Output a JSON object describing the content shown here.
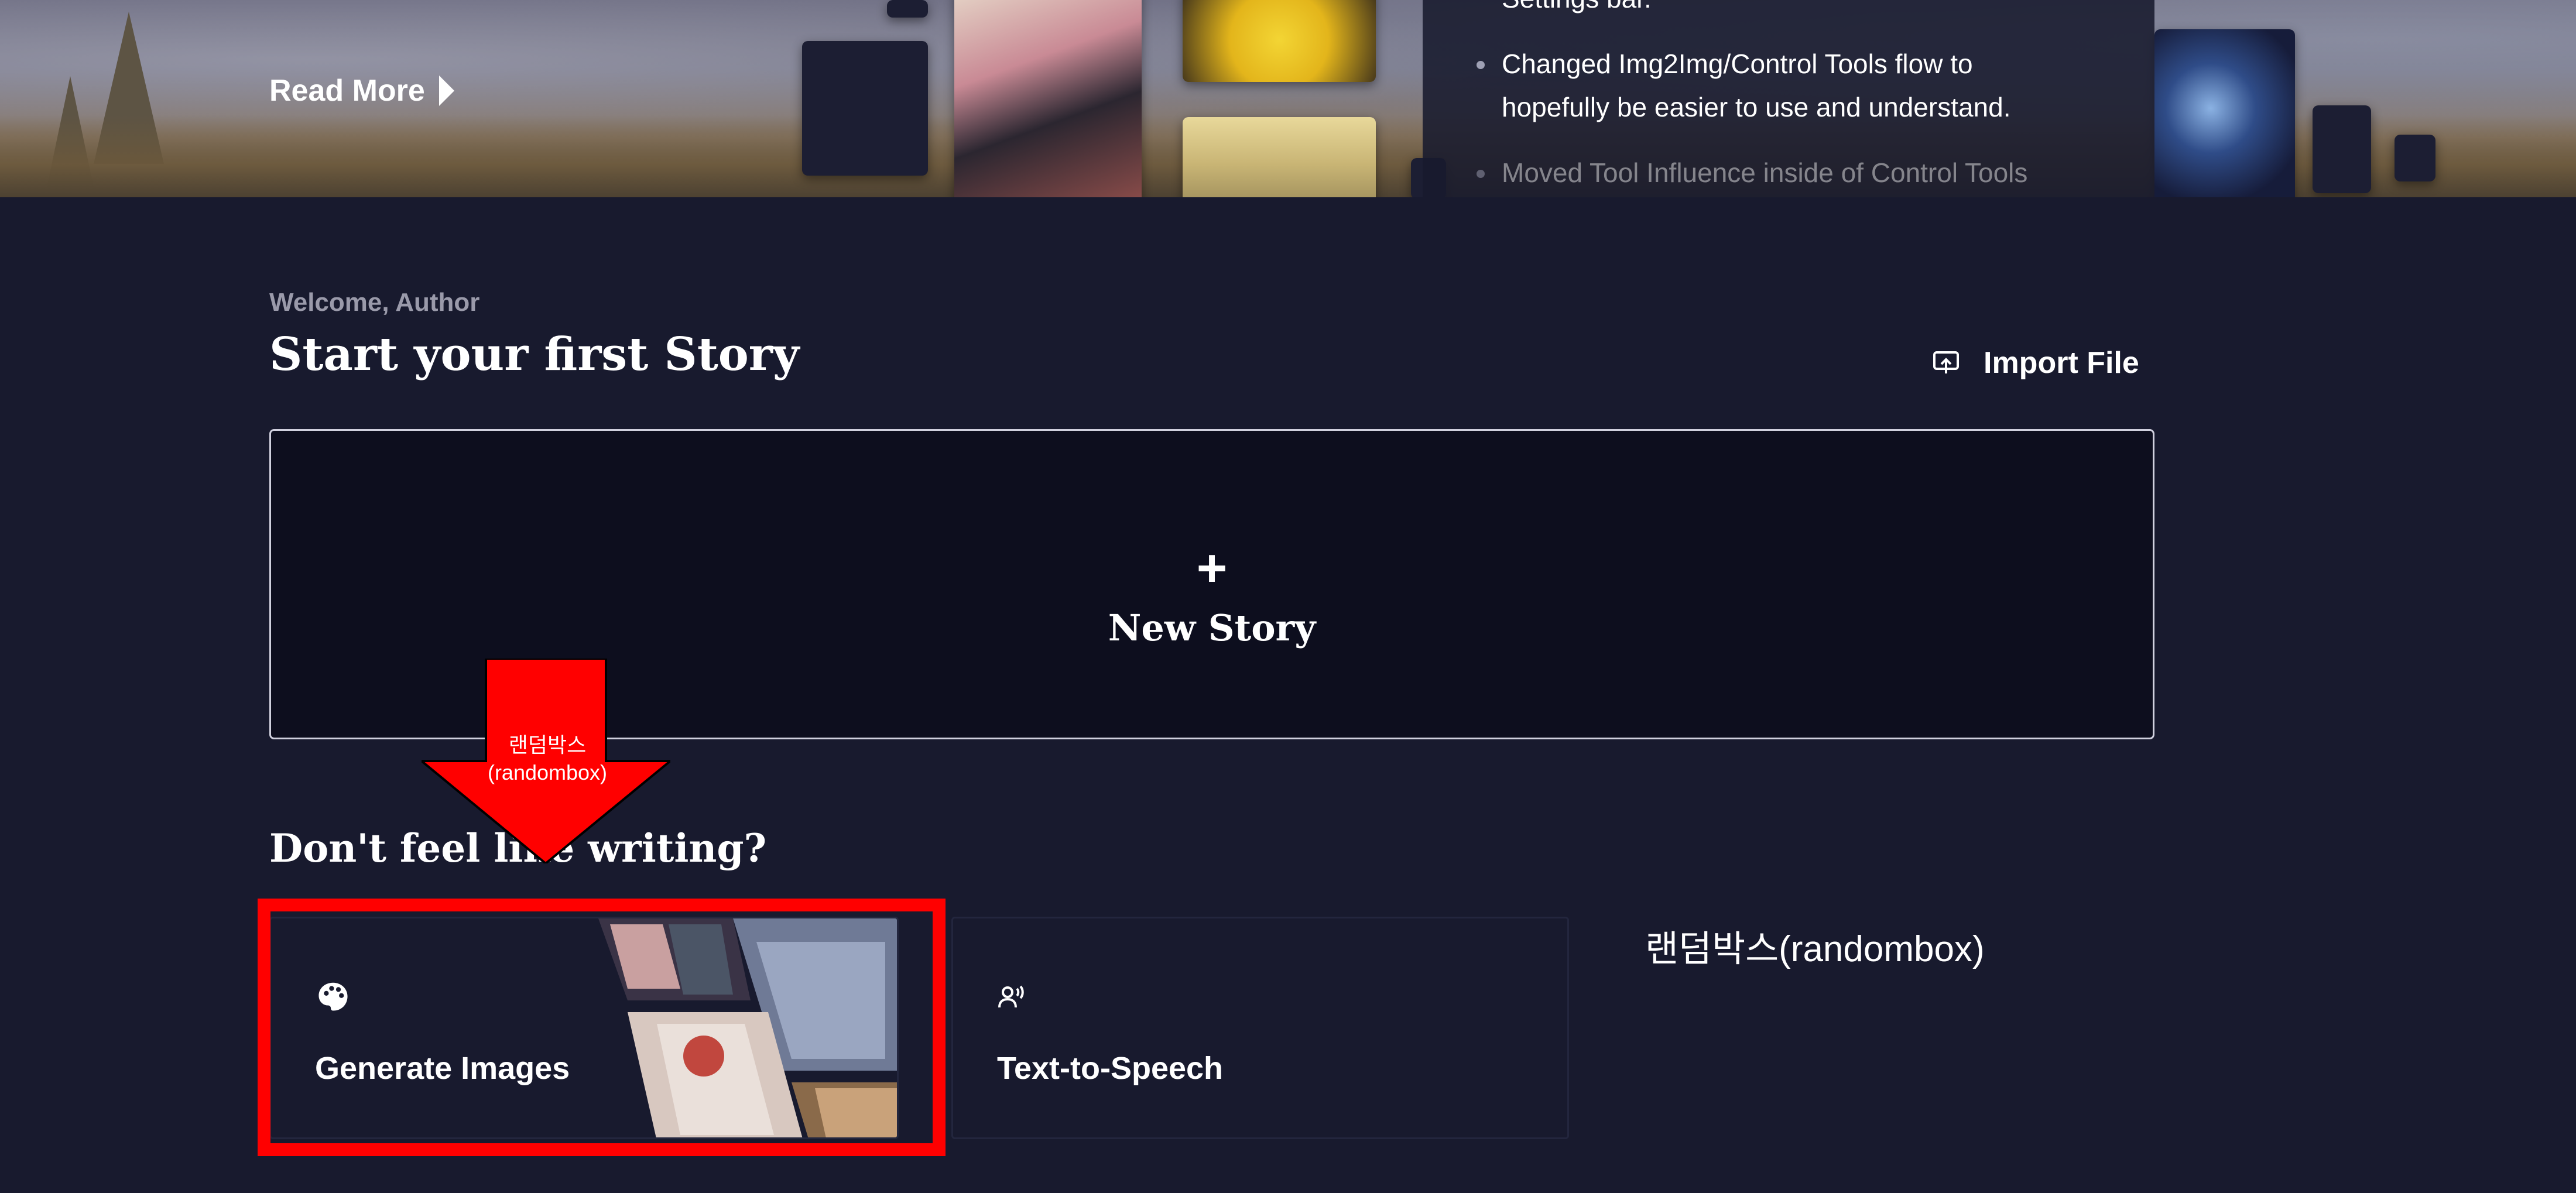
{
  "banner": {
    "read_more": "Read More",
    "notes": [
      "Settings bar.",
      "Changed Img2Img/Control Tools flow to",
      "hopefully be easier to use and understand.",
      "Moved Tool Influence inside of Control Tools"
    ]
  },
  "main": {
    "welcome": "Welcome, Author",
    "title": "Start your first Story",
    "import_label": "Import File",
    "new_story_plus": "+",
    "new_story_label": "New Story",
    "subtitle": "Don't feel like writing?"
  },
  "cards": {
    "generate_images": "Generate Images",
    "text_to_speech": "Text-to-Speech"
  },
  "annotation": {
    "arrow_label_ko": "랜덤박스",
    "arrow_label_en": "(randombox)",
    "side_label": "랜덤박스(randombox)",
    "color": "#ff0000"
  },
  "colors": {
    "background": "#181a2e",
    "card_background": "#0d0e1e",
    "accent_text": "#ffffff",
    "muted_text": "#9a9aaa"
  },
  "icons": {
    "read_more": "triangle-right-icon",
    "import": "upload-icon",
    "generate_images": "palette-icon",
    "text_to_speech": "speaking-head-icon"
  }
}
